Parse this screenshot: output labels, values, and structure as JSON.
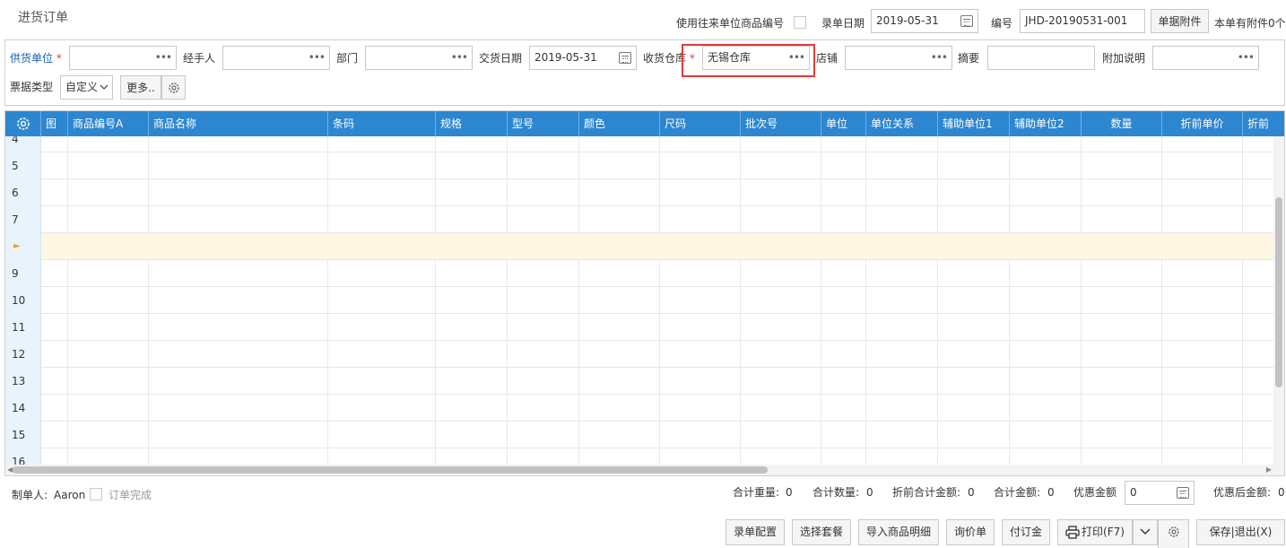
{
  "title": "进货订单",
  "top": {
    "use_code_label": "使用往来单位商品编号",
    "entry_date_label": "录单日期",
    "entry_date_value": "2019-05-31",
    "code_label": "编号",
    "code_value": "JHD-20190531-001",
    "attach_button": "单据附件",
    "attach_count": "本单有附件0个"
  },
  "filters": {
    "supplier_label": "供货单位",
    "required_mark": "*",
    "handler_label": "经手人",
    "dept_label": "部门",
    "delivery_date_label": "交货日期",
    "delivery_date_value": "2019-05-31",
    "warehouse_label": "收货仓库",
    "warehouse_value": "无锡仓库",
    "store_label": "店铺",
    "summary_label": "摘要",
    "note_label": "附加说明",
    "doc_type_label": "票据类型",
    "doc_type_value": "自定义",
    "more_button": "更多..",
    "dots": "•••"
  },
  "grid": {
    "headers": [
      "图",
      "商品编号A",
      "商品名称",
      "条码",
      "规格",
      "型号",
      "颜色",
      "尺码",
      "批次号",
      "单位",
      "单位关系",
      "辅助单位1",
      "辅助单位2",
      "数量",
      "折前单价",
      "折前"
    ],
    "row_numbers": [
      "4",
      "5",
      "6",
      "7",
      "►",
      "9",
      "10",
      "11",
      "12",
      "13",
      "14",
      "15",
      "16"
    ]
  },
  "footer": {
    "maker_label": "制单人:",
    "maker_value": "Aaron",
    "order_done_label": "订单完成",
    "total_weight_label": "合计重量:",
    "total_weight_value": "0",
    "total_qty_label": "合计数量:",
    "total_qty_value": "0",
    "pre_total_label": "折前合计金额:",
    "pre_total_value": "0",
    "total_amount_label": "合计金额:",
    "total_amount_value": "0",
    "discount_label": "优惠金额",
    "discount_value": "0",
    "after_discount_label": "优惠后金额:",
    "after_discount_value": "0"
  },
  "actions": {
    "config": "录单配置",
    "package": "选择套餐",
    "import": "导入商品明细",
    "inquiry": "询价单",
    "deposit": "付订金",
    "print": "打印(F7)",
    "save_exit": "保存|退出(X)"
  }
}
